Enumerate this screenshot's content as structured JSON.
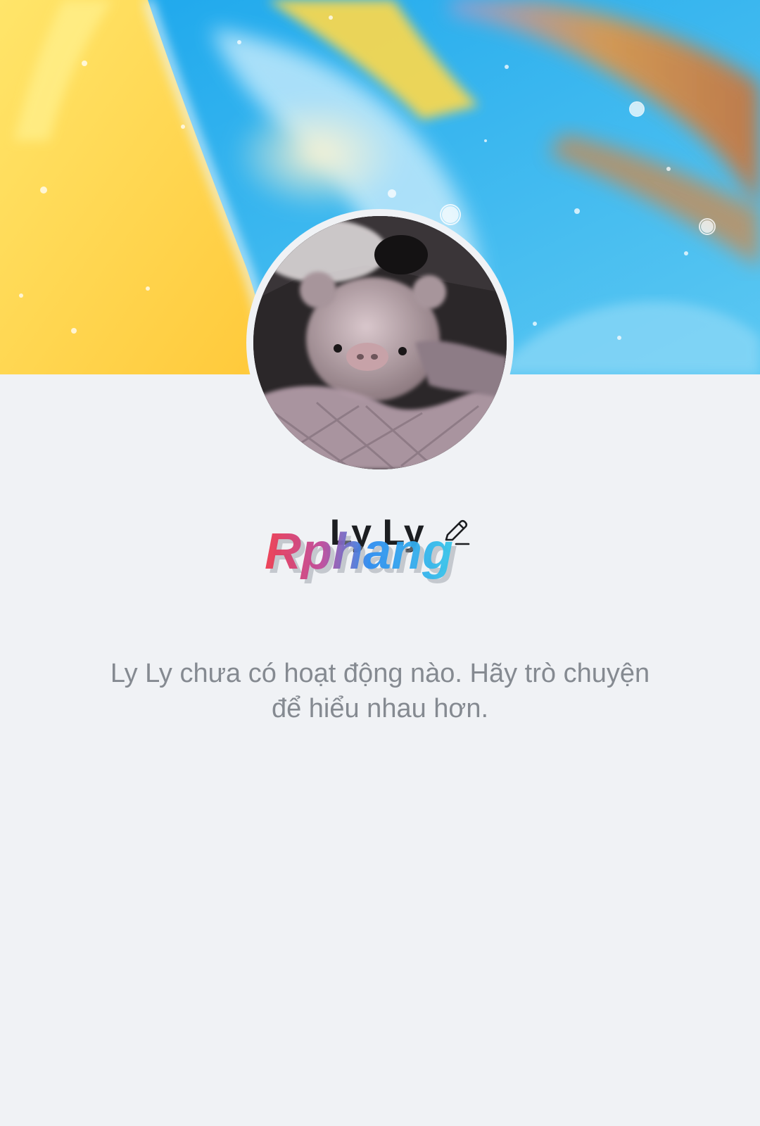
{
  "profile": {
    "name": "Ly Ly",
    "edit_icon": "pencil-icon"
  },
  "watermark": {
    "text": "Rphang"
  },
  "empty_state": {
    "line1": "Ly Ly chưa có hoạt động nào. Hãy trò chuyện",
    "line2": "để hiểu nhau hơn."
  },
  "colors": {
    "background": "#f0f2f5",
    "name_text": "#1c1e21",
    "muted_text": "#858a91",
    "cover_yellow": "#ffd94a",
    "cover_blue": "#2fb3ef",
    "cover_orange": "#e08a3c",
    "watermark_red": "#ee3b4f",
    "watermark_blue": "#2f8df0"
  },
  "icons": {
    "cover": "abstract-liquid-cover-image",
    "avatar": "teddy-pig-avatar-image"
  }
}
